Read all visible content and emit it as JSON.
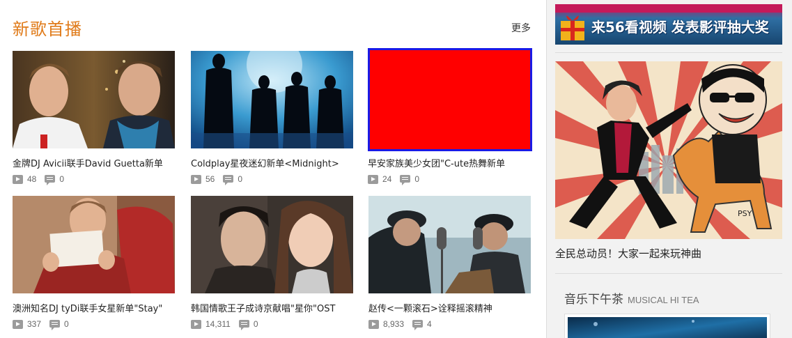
{
  "section": {
    "title": "新歌首播",
    "more_label": "更多"
  },
  "videos": [
    {
      "title": "金牌DJ Avicii联手David Guetta新单",
      "plays": "48",
      "comments": "0",
      "thumb": "two-djs-portrait"
    },
    {
      "title": "Coldplay星夜迷幻新单<Midnight>",
      "plays": "56",
      "comments": "0",
      "thumb": "band-silhouette-blue"
    },
    {
      "title": "早安家族美少女团\"C-ute热舞新单",
      "plays": "24",
      "comments": "0",
      "thumb": "red-placeholder"
    },
    {
      "title": "澳洲知名DJ tyDi联手女星新单\"Stay\"",
      "plays": "337",
      "comments": "0",
      "thumb": "man-holding-paper"
    },
    {
      "title": "韩国情歌王子成诗京献唱\"星你\"OST",
      "plays": "14,311",
      "comments": "0",
      "thumb": "drama-couple"
    },
    {
      "title": "赵传<一颗滚石>诠释摇滚精神",
      "plays": "8,933",
      "comments": "4",
      "thumb": "recording-studio"
    }
  ],
  "sidebar": {
    "banner_text": "来56看视频 发表影评抽大奖",
    "poster_caption": "全民总动员！大家一起来玩神曲",
    "poster_badge": "PSY",
    "tea_title": "音乐下午茶",
    "tea_subtitle": "MUSICAL HI TEA"
  },
  "colors": {
    "accent": "#e07b1a",
    "icon": "#9b9b9b",
    "placeholder_red": "#ff0000",
    "placeholder_border": "#1a1ae6"
  }
}
